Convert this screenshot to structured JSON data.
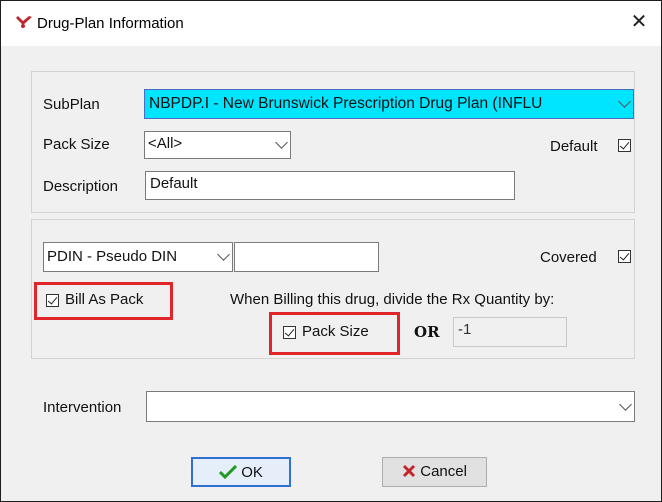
{
  "window": {
    "title": "Drug-Plan Information"
  },
  "plan_section": {
    "subplan_label": "SubPlan",
    "subplan_value": "NBPDP.I - New Brunswick Prescription Drug Plan (INFLU",
    "pack_size_label": "Pack Size",
    "pack_size_value": "<All>",
    "default_label": "Default",
    "default_checked": true,
    "description_label": "Description",
    "description_value": "Default"
  },
  "billing_section": {
    "pdin_value": "PDIN - Pseudo DIN",
    "pdin_text_value": "",
    "covered_label": "Covered",
    "covered_checked": true,
    "bill_as_pack_label": "Bill As Pack",
    "bill_as_pack_checked": true,
    "divide_text": "When Billing this drug, divide the Rx Quantity by:",
    "pack_size_label": "Pack Size",
    "pack_size_checked": true,
    "or_label": "OR",
    "quantity_value": "-1"
  },
  "intervention": {
    "label": "Intervention",
    "value": ""
  },
  "buttons": {
    "ok_label": "OK",
    "cancel_label": "Cancel"
  },
  "colors": {
    "selection": "#00e5ff",
    "highlight": "#e0252b",
    "default_button_border": "#2f6fd6"
  },
  "icons": {
    "app": "dropper-icon",
    "close": "close-icon",
    "ok": "checkmark-icon",
    "cancel": "x-icon"
  }
}
